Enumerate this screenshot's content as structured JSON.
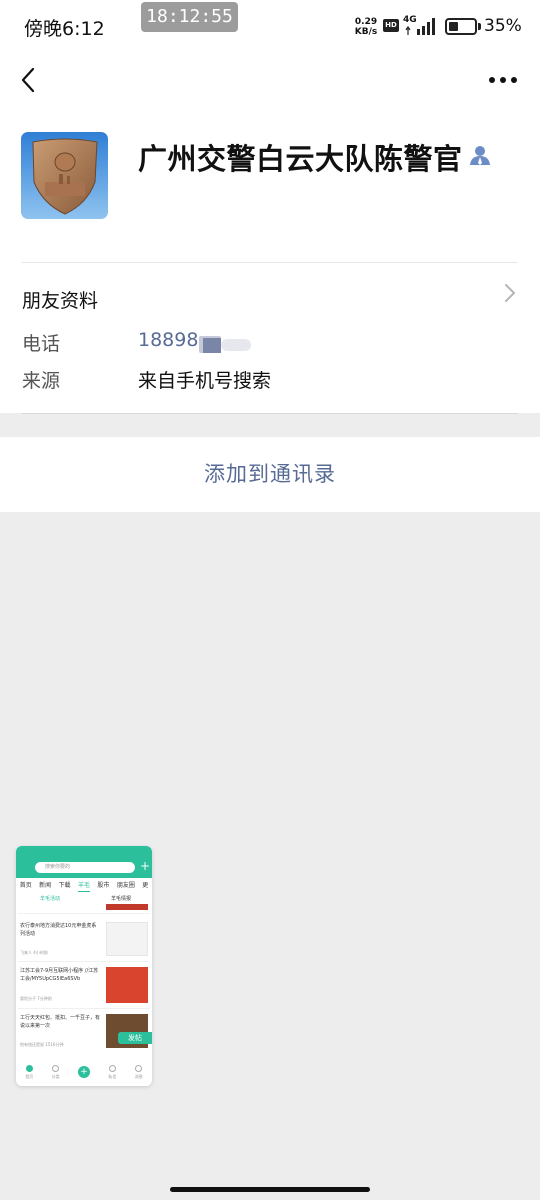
{
  "status_bar": {
    "time": "傍晚6:12",
    "recording_time": "18:12:55",
    "net_speed_value": "0.29",
    "net_speed_unit": "KB/s",
    "hd": "HD",
    "net_type": "4G",
    "battery": "35%"
  },
  "profile": {
    "name": "广州交警白云大队陈警官"
  },
  "section": {
    "title": "朋友资料"
  },
  "rows": [
    {
      "label": "电话",
      "value": "18898"
    },
    {
      "label": "来源",
      "value": "来自手机号搜索"
    }
  ],
  "actions": {
    "add_contacts": "添加到通讯录"
  },
  "thumbnail": {
    "search_placeholder": "搜索你要的",
    "tabs": [
      "首页",
      "新闻",
      "下载",
      "羊毛",
      "股市",
      "朋友圈",
      "更"
    ],
    "active_tab": "羊毛",
    "sub_tabs": [
      "羊毛活动",
      "羊毛情报"
    ],
    "items": [
      {
        "text": "农行泰州地方消费达10元申金虎系列活动",
        "meta": "飞来人  4小时前"
      },
      {
        "text": "江苏工会7-9月互联网小程序 //江苏工会/MY5UpCG5lEa6SVb",
        "meta": "冒险分子  7分钟前"
      },
      {
        "text": "工行天天红包、抵扣、一千豆子，有说以来第一次",
        "meta": "他有钱还是说  1516分钟"
      }
    ],
    "float_label": "发帖",
    "nav": [
      "首页",
      "分类",
      "",
      "私信",
      "消息"
    ]
  }
}
